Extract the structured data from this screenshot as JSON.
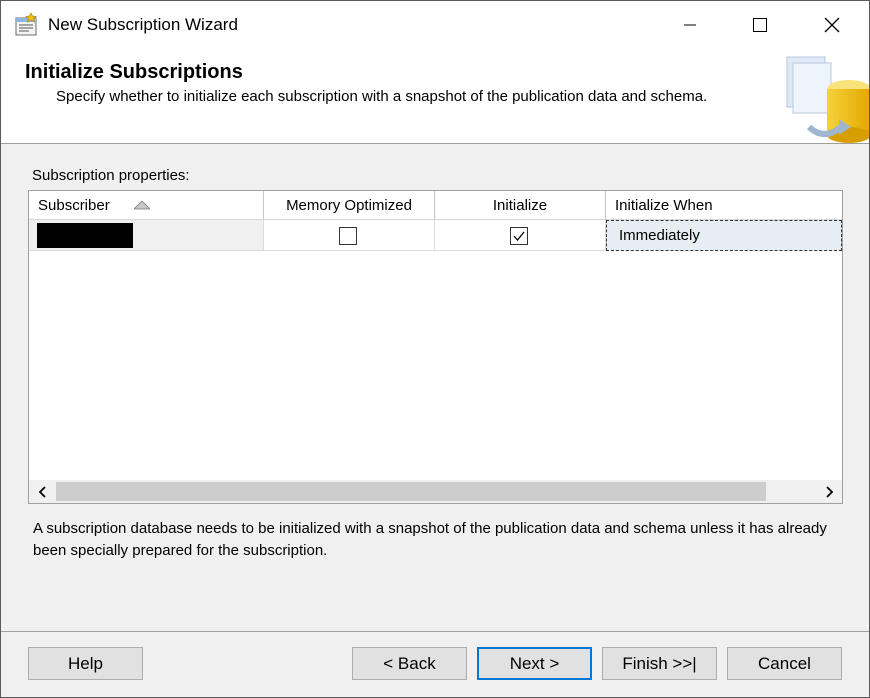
{
  "window": {
    "title": "New Subscription Wizard"
  },
  "header": {
    "title": "Initialize Subscriptions",
    "subtitle": "Specify whether to initialize each subscription with a snapshot of the publication data and schema."
  },
  "grid": {
    "label": "Subscription properties:",
    "columns": [
      "Subscriber",
      "Memory Optimized",
      "Initialize",
      "Initialize When"
    ],
    "rows": [
      {
        "subscriber": "",
        "memory_optimized": false,
        "initialize": true,
        "initialize_when": "Immediately"
      }
    ]
  },
  "info_text": "A subscription database needs to be initialized with a snapshot of the publication data and schema unless it has already been specially prepared for the subscription.",
  "buttons": {
    "help": "Help",
    "back": "< Back",
    "next": "Next >",
    "finish": "Finish >>|",
    "cancel": "Cancel"
  }
}
